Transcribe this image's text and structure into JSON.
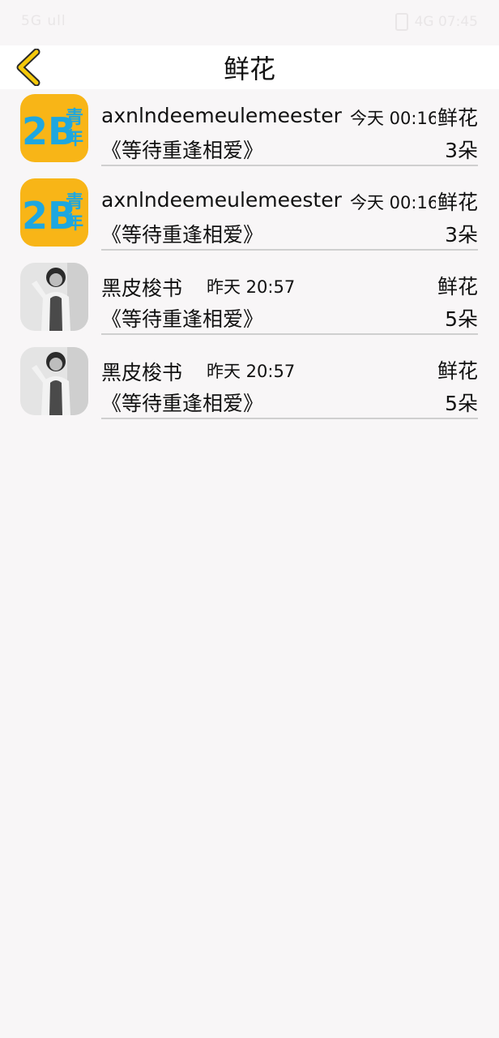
{
  "status_bar": {
    "left": "5G ull",
    "right": "4G 07:45"
  },
  "header": {
    "title": "鲜花",
    "back_icon": "chevron-left-icon",
    "accent_color": "#f5c90a"
  },
  "list": [
    {
      "sender": "axnlndeemeulemeester",
      "time": "今天 00:16",
      "book": "《等待重逢相爱》",
      "gift": "鲜花",
      "count": "3朵",
      "avatar": "logo-2b-youth"
    },
    {
      "sender": "axnlndeemeulemeester",
      "time": "今天 00:16",
      "book": "《等待重逢相爱》",
      "gift": "鲜花",
      "count": "3朵",
      "avatar": "logo-2b-youth"
    },
    {
      "sender": "黑皮梭书",
      "time": "昨天 20:57",
      "book": "《等待重逢相爱》",
      "gift": "鲜花",
      "count": "5朵",
      "avatar": "person-photo"
    },
    {
      "sender": "黑皮梭书",
      "time": "昨天 20:57",
      "book": "《等待重逢相爱》",
      "gift": "鲜花",
      "count": "5朵",
      "avatar": "person-photo"
    }
  ]
}
